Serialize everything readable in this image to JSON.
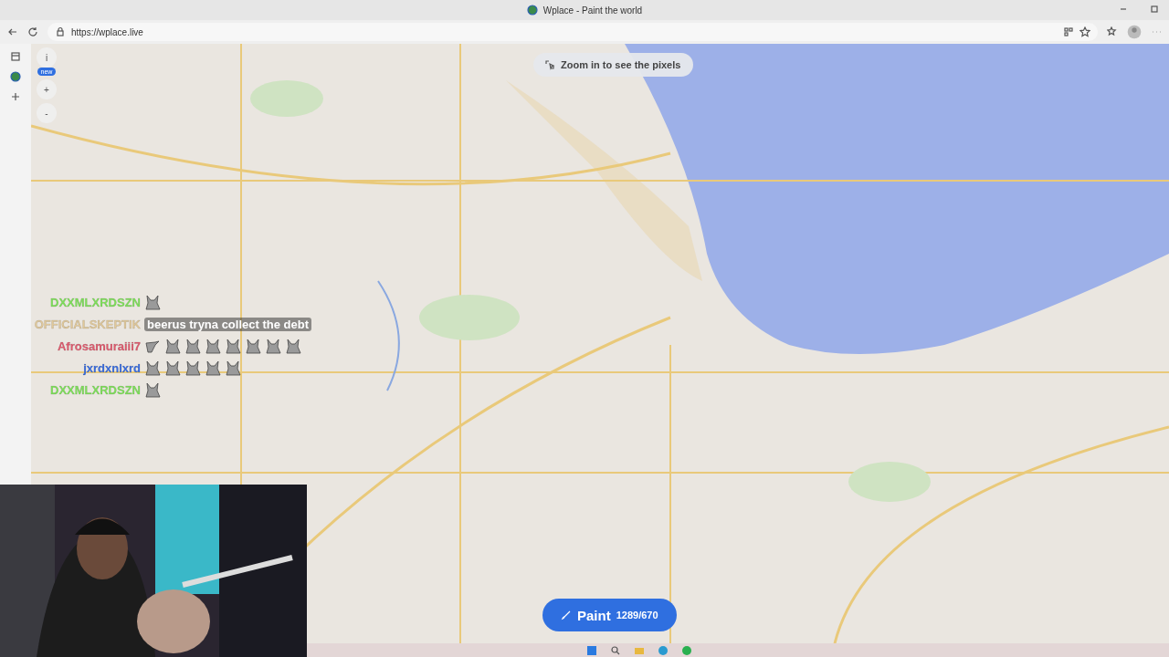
{
  "window": {
    "title": "Wplace - Paint the world"
  },
  "address_bar": {
    "url": "https://wplace.live"
  },
  "map_controls": {
    "info": "i",
    "badge": "new",
    "zoom_in": "+",
    "zoom_out": "-"
  },
  "zoom_hint": "Zoom in to see the pixels",
  "chat": [
    {
      "user": "DXXMLXRDSZN",
      "color": "#7ee05a",
      "emotes": [
        {
          "kind": "cat"
        }
      ]
    },
    {
      "user": "OFFICIALSKEPTIK",
      "color": "#e0c89a",
      "message": "beerus tryna collect the debt"
    },
    {
      "user": "Afrosamuraiii7",
      "color": "#e05a6e",
      "emotes": [
        {
          "kind": "pointing"
        },
        {
          "kind": "cat"
        },
        {
          "kind": "cat"
        },
        {
          "kind": "cat"
        },
        {
          "kind": "cat"
        },
        {
          "kind": "cat"
        },
        {
          "kind": "cat"
        },
        {
          "kind": "cat"
        }
      ]
    },
    {
      "user": "jxrdxnlxrd",
      "color": "#3a6ee0",
      "emotes": [
        {
          "kind": "cat"
        },
        {
          "kind": "cat"
        },
        {
          "kind": "cat"
        },
        {
          "kind": "cat"
        },
        {
          "kind": "cat"
        }
      ]
    },
    {
      "user": "DXXMLXRDSZN",
      "color": "#7ee05a",
      "emotes": [
        {
          "kind": "cat"
        }
      ]
    }
  ],
  "paint_button": {
    "label": "Paint",
    "count": "1289/670"
  }
}
